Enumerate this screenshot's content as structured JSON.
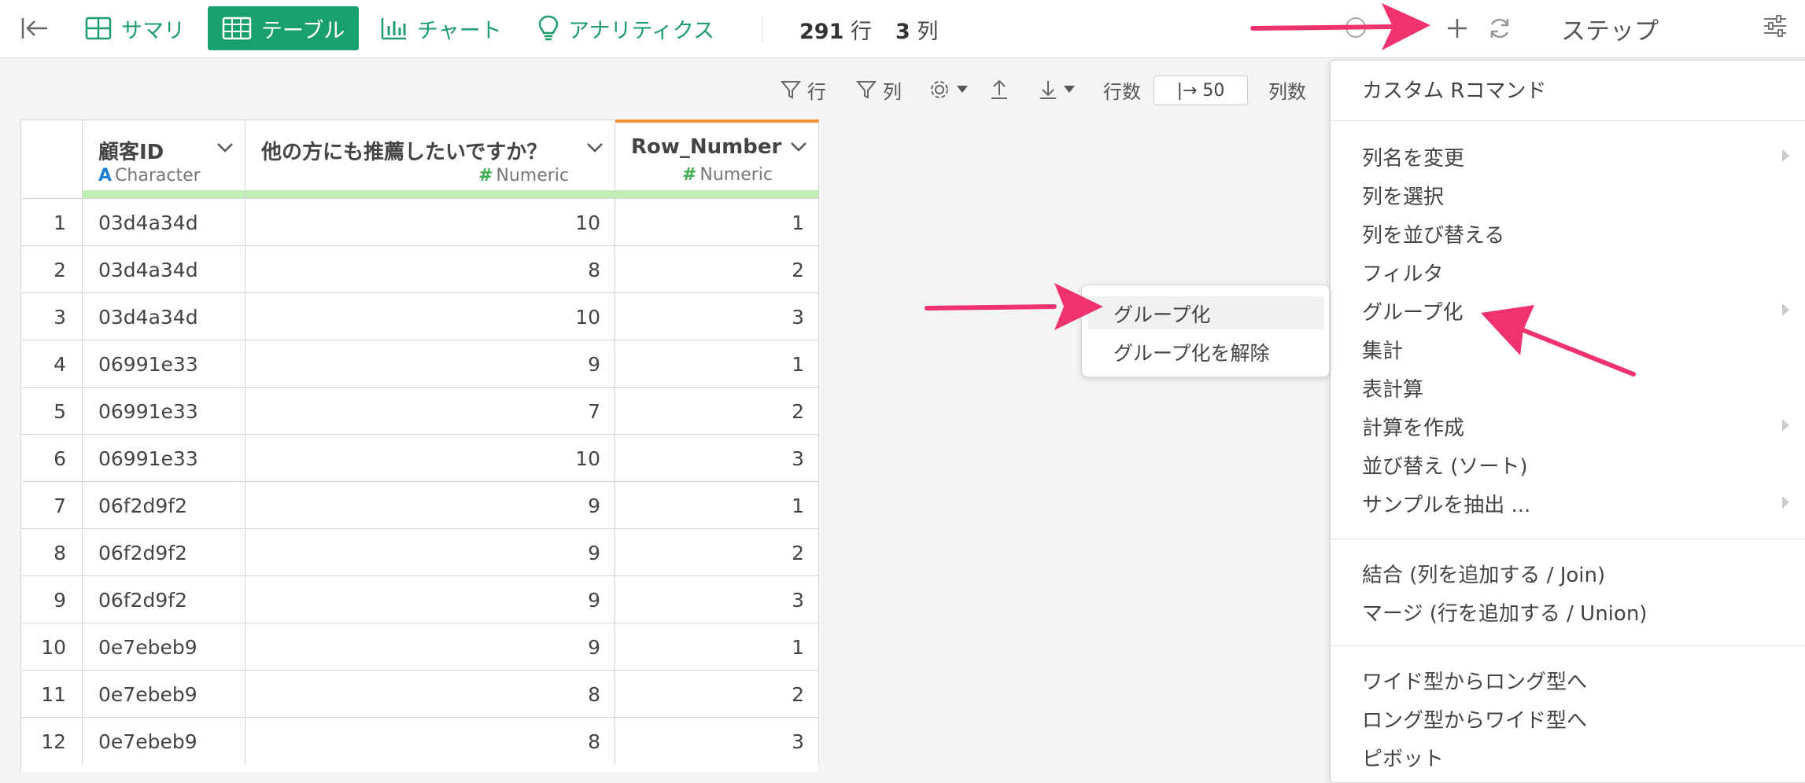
{
  "toolbar": {
    "tabs": [
      {
        "label": "サマリ",
        "icon": "summary-grid-icon"
      },
      {
        "label": "テーブル",
        "icon": "table-icon"
      },
      {
        "label": "チャート",
        "icon": "bar-chart-icon"
      },
      {
        "label": "アナリティクス",
        "icon": "lightbulb-icon"
      }
    ],
    "rows_count": "291",
    "rows_unit": "行",
    "cols_count": "3",
    "cols_unit": "列",
    "steps_label": "ステップ"
  },
  "subtoolbar": {
    "row_filter": "行",
    "col_filter": "列",
    "rows_label": "行数",
    "rows_value": "|→ 50",
    "cols_label": "列数"
  },
  "table": {
    "columns": [
      {
        "name": "顧客ID",
        "type_mark": "A",
        "type": "Character"
      },
      {
        "name": "他の方にも推薦したいですか？",
        "type_mark": "#",
        "type": "Numeric"
      },
      {
        "name": "Row_Number",
        "type_mark": "#",
        "type": "Numeric"
      }
    ],
    "rows": [
      {
        "n": "1",
        "id": "03d4a34d",
        "score": "10",
        "rn": "1"
      },
      {
        "n": "2",
        "id": "03d4a34d",
        "score": "8",
        "rn": "2"
      },
      {
        "n": "3",
        "id": "03d4a34d",
        "score": "10",
        "rn": "3"
      },
      {
        "n": "4",
        "id": "06991e33",
        "score": "9",
        "rn": "1"
      },
      {
        "n": "5",
        "id": "06991e33",
        "score": "7",
        "rn": "2"
      },
      {
        "n": "6",
        "id": "06991e33",
        "score": "10",
        "rn": "3"
      },
      {
        "n": "7",
        "id": "06f2d9f2",
        "score": "9",
        "rn": "1"
      },
      {
        "n": "8",
        "id": "06f2d9f2",
        "score": "9",
        "rn": "2"
      },
      {
        "n": "9",
        "id": "06f2d9f2",
        "score": "9",
        "rn": "3"
      },
      {
        "n": "10",
        "id": "0e7ebeb9",
        "score": "9",
        "rn": "1"
      },
      {
        "n": "11",
        "id": "0e7ebeb9",
        "score": "8",
        "rn": "2"
      },
      {
        "n": "12",
        "id": "0e7ebeb9",
        "score": "8",
        "rn": "3"
      }
    ]
  },
  "menu": {
    "items": [
      {
        "label": "カスタム Rコマンド",
        "submenu": false
      },
      {
        "label": "列名を変更",
        "submenu": true
      },
      {
        "label": "列を選択",
        "submenu": false
      },
      {
        "label": "列を並び替える",
        "submenu": false
      },
      {
        "label": "フィルタ",
        "submenu": false
      },
      {
        "label": "グループ化",
        "submenu": true
      },
      {
        "label": "集計",
        "submenu": false
      },
      {
        "label": "表計算",
        "submenu": false
      },
      {
        "label": "計算を作成",
        "submenu": true
      },
      {
        "label": "並び替え (ソート)",
        "submenu": false
      },
      {
        "label": "サンプルを抽出 ...",
        "submenu": true
      },
      {
        "label": "結合 (列を追加する / Join)",
        "submenu": false
      },
      {
        "label": "マージ (行を追加する / Union)",
        "submenu": false
      },
      {
        "label": "ワイド型からロング型へ",
        "submenu": false
      },
      {
        "label": "ロング型からワイド型へ",
        "submenu": false
      },
      {
        "label": "ピボット",
        "submenu": false
      }
    ]
  },
  "submenu": {
    "items": [
      {
        "label": "グループ化"
      },
      {
        "label": "グループ化を解除"
      }
    ]
  },
  "colors": {
    "accent_green": "#1aa06d",
    "annotation_arrow": "#f0336e",
    "sort_bar": "#f0913a",
    "character_type": "#1f7fd1",
    "numeric_type": "#3fae52"
  }
}
